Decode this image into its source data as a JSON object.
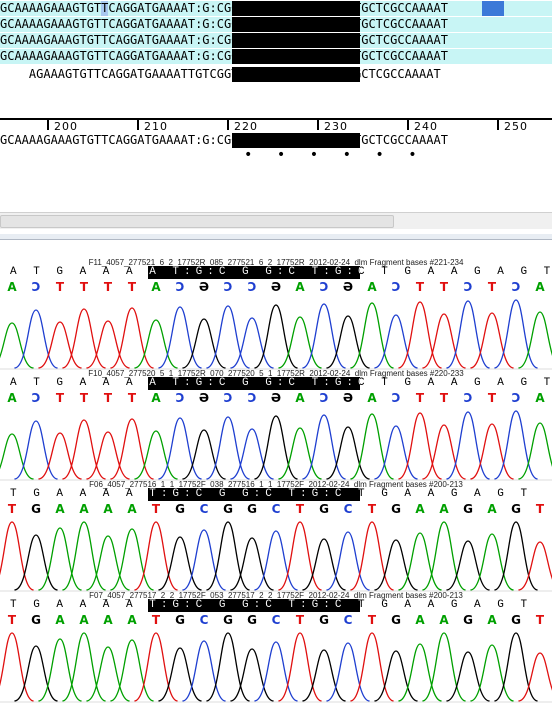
{
  "alignment": {
    "rows": [
      {
        "text": "GCAAAAGAAAGTGTTCAGGATGAAAAT:G:CGG:CT:G:CTGAAGAGTTTGCTCGCCAAAAT",
        "bg": "#c8f5f5"
      },
      {
        "text": "GCAAAAGAAAGTGTTCAGGATGAAAAT:G:CGG:CT:G:CTGAAGAGTTTGCTCGCCAAAAT",
        "bg": "#c8f5f5"
      },
      {
        "text": "GCAAAAGAAAGTGTTCAGGATGAAAAT:G:CGG:CT:G:CTGAAGAGTTTGCTCGCCAAAAT",
        "bg": "#c8f5f5"
      },
      {
        "text": "GCAAAAGAAAGTGTTCAGGATGAAAAT:G:CGG:CT:G:CTGAAGAGTTTGCTCGCCAAAAT",
        "bg": "#c8f5f5"
      },
      {
        "text": "    AGAAAGTGTTCAGGATGAAAATTGTCGGTCTTGTCTGAAGAGTTTGCTCGCCAAAAT",
        "bg": "#ffffff"
      }
    ],
    "consensus": "GCAAAAGAAAGTGTTCAGGATGAAAAT:G:CGG:CT:G:CTGAAGAGTTTGCTCGCCAAAAT",
    "ruler_labels": [
      "200",
      "210",
      "220",
      "230",
      "240",
      "250"
    ],
    "variant_dots": "• • • • • •"
  },
  "traces": [
    {
      "name": "F11_4057_277521_6_2_17752R_085_277521_6_2_17752R_2012-02-24_dlm Fragment bases #221-234",
      "calls_text": "A T G A A A A T:G:C G G:C T:G:C T G A A G A G T",
      "bases": [
        "A",
        "Ɔ",
        "T",
        "T",
        "T",
        "T",
        "A",
        "Ɔ",
        "Ә",
        "Ɔ",
        "Ɔ",
        "Ә",
        "A",
        "Ɔ",
        "Ә",
        "A",
        "Ɔ",
        "T",
        "T",
        "Ɔ",
        "T",
        "Ɔ",
        "A"
      ]
    },
    {
      "name": "F10_4057_277520_5_1_17752R_070_277520_5_1_17752R_2012-02-24_dlm Fragment bases #220-233",
      "calls_text": "A T G A A A A T:G:C G G:C T:G:C T G A A G A G T",
      "bases": [
        "A",
        "Ɔ",
        "T",
        "T",
        "T",
        "T",
        "A",
        "Ɔ",
        "Ә",
        "Ɔ",
        "Ɔ",
        "Ә",
        "A",
        "Ɔ",
        "Ә",
        "A",
        "Ɔ",
        "T",
        "T",
        "Ɔ",
        "T",
        "Ɔ",
        "A"
      ]
    },
    {
      "name": "F06_4057_277516_1_1_17752F_038_277516_1_1_17752F_2012-02-24_dlm Fragment bases #200-213",
      "calls_text": "T G A A A A T:G:C G G:C T:G:C T G A A G A G T",
      "bases": [
        "T",
        "G",
        "A",
        "A",
        "A",
        "A",
        "T",
        "G",
        "C",
        "G",
        "G",
        "C",
        "T",
        "G",
        "C",
        "T",
        "G",
        "A",
        "A",
        "G",
        "A",
        "G",
        "T"
      ]
    },
    {
      "name": "F07_4057_277517_2_2_17752F_053_277517_2_2_17752F_2012-02-24_dlm Fragment bases #200-213",
      "calls_text": "T G A A A A T:G:C G G:C T:G:C T G A A G A G T",
      "bases": [
        "T",
        "G",
        "A",
        "A",
        "A",
        "A",
        "T",
        "G",
        "C",
        "G",
        "G",
        "C",
        "T",
        "G",
        "C",
        "T",
        "G",
        "A",
        "A",
        "G",
        "A",
        "G",
        "T"
      ]
    }
  ],
  "colors": {
    "A": "#00a000",
    "C": "#1f3fd0",
    "G": "#000000",
    "T": "#e01010",
    "Ɔ": "#1f3fd0",
    "Ә": "#000000",
    "highlight_blue": "#3b79d8",
    "highlight_light": "#a9c8ef"
  }
}
